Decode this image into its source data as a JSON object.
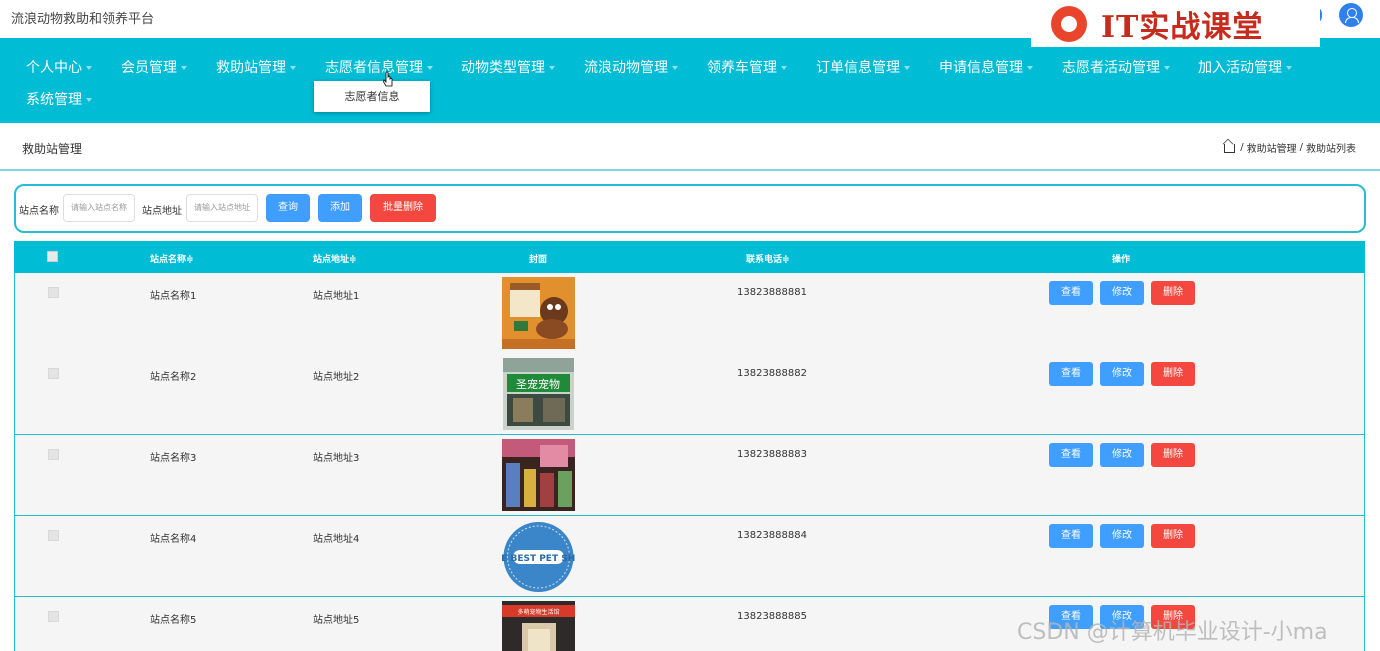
{
  "app": {
    "title": "流浪动物救助和领养平台"
  },
  "watermark": {
    "text": "IT实战课堂",
    "csdn": "CSDN @计算机毕业设计-小ma"
  },
  "nav": {
    "items": [
      "个人中心",
      "会员管理",
      "救助站管理",
      "志愿者信息管理",
      "动物类型管理",
      "流浪动物管理",
      "领养车管理",
      "订单信息管理",
      "申请信息管理",
      "志愿者活动管理",
      "加入活动管理",
      "系统管理"
    ],
    "dropdown_item": "志愿者信息"
  },
  "page": {
    "title": "救助站管理",
    "breadcrumb": [
      "救助站管理",
      "救助站列表"
    ]
  },
  "search": {
    "name_label": "站点名称",
    "name_placeholder": "请输入站点名称",
    "address_label": "站点地址",
    "address_placeholder": "请输入站点地址",
    "query_btn": "查询",
    "add_btn": "添加",
    "batch_delete_btn": "批量删除"
  },
  "table": {
    "headers": [
      "站点名称",
      "站点地址",
      "封面",
      "联系电话",
      "操作"
    ],
    "rows": [
      {
        "name": "站点名称1",
        "address": "站点地址1",
        "phone": "13823888881"
      },
      {
        "name": "站点名称2",
        "address": "站点地址2",
        "phone": "13823888882"
      },
      {
        "name": "站点名称3",
        "address": "站点地址3",
        "phone": "13823888883"
      },
      {
        "name": "站点名称4",
        "address": "站点地址4",
        "phone": "13823888884"
      },
      {
        "name": "站点名称5",
        "address": "站点地址5",
        "phone": "13823888885"
      }
    ],
    "actions": {
      "view": "查看",
      "edit": "修改",
      "delete": "删除"
    }
  },
  "images": {
    "cover4_text": "THE BEST PET SHOP",
    "cover2_text": "圣宠宠物",
    "cover5_text": "多萌宠物生活馆"
  },
  "colors": {
    "primary": "#00bcd4",
    "blue": "#409eff",
    "red": "#f4473f"
  }
}
